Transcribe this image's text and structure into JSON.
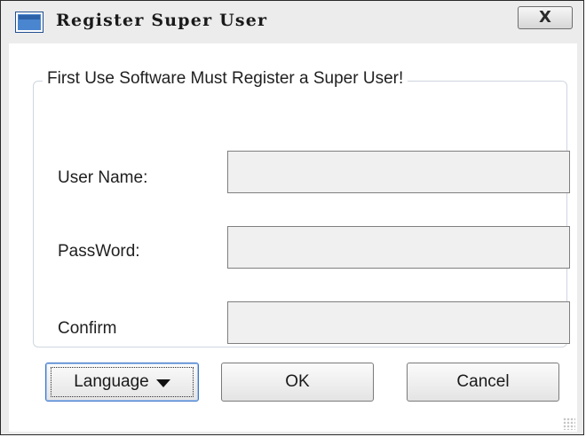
{
  "window": {
    "title": "Register Super User",
    "close_glyph": "X",
    "app_icon": "window-app-icon"
  },
  "form": {
    "group_title": "First Use Software Must Register a Super User!",
    "fields": [
      {
        "label": "User Name:",
        "value": ""
      },
      {
        "label": "PassWord:",
        "value": ""
      },
      {
        "label": "Confirm",
        "value": ""
      }
    ]
  },
  "buttons": {
    "language": "Language",
    "ok": "OK",
    "cancel": "Cancel"
  },
  "icons": {
    "dropdown": "dropdown-arrow-icon",
    "resize": "resize-grip-icon"
  }
}
